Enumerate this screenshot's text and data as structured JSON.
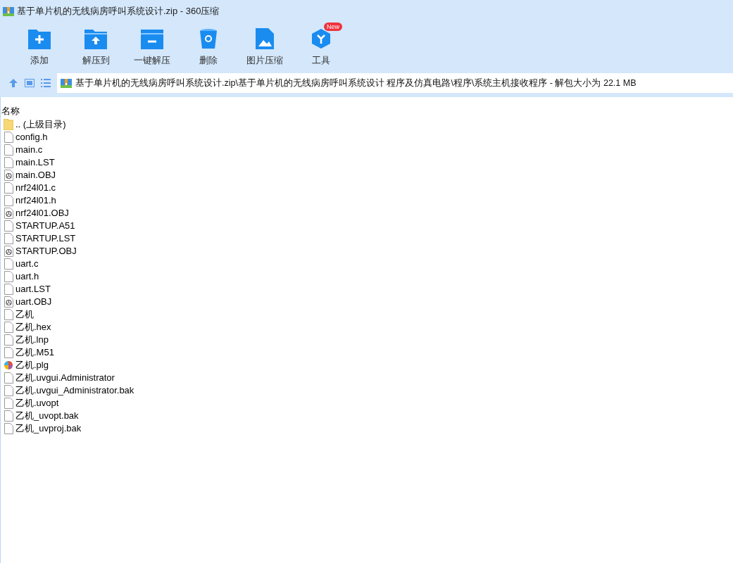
{
  "window": {
    "title": "基于单片机的无线病房呼叫系统设计.zip - 360压缩"
  },
  "toolbar": [
    {
      "kind": "add",
      "label": "添加"
    },
    {
      "kind": "extract",
      "label": "解压到"
    },
    {
      "kind": "oneclick",
      "label": "一键解压"
    },
    {
      "kind": "delete",
      "label": "删除"
    },
    {
      "kind": "image",
      "label": "图片压缩"
    },
    {
      "kind": "tools",
      "label": "工具",
      "badge": "New"
    }
  ],
  "address": {
    "path": "基于单片机的无线病房呼叫系统设计.zip\\基于单片机的无线病房呼叫系统设计 程序及仿真电路\\程序\\系统主机接收程序 - 解包大小为 22.1 MB"
  },
  "table": {
    "columns": [
      "名称"
    ],
    "rows": [
      {
        "kind": "folder",
        "name": ".. (上级目录)"
      },
      {
        "kind": "file",
        "name": "config.h"
      },
      {
        "kind": "file",
        "name": "main.c"
      },
      {
        "kind": "file",
        "name": "main.LST"
      },
      {
        "kind": "obj",
        "name": "main.OBJ"
      },
      {
        "kind": "file",
        "name": "nrf24l01.c"
      },
      {
        "kind": "file",
        "name": "nrf24l01.h"
      },
      {
        "kind": "obj",
        "name": "nrf24l01.OBJ"
      },
      {
        "kind": "file",
        "name": "STARTUP.A51"
      },
      {
        "kind": "file",
        "name": "STARTUP.LST"
      },
      {
        "kind": "obj",
        "name": "STARTUP.OBJ"
      },
      {
        "kind": "file",
        "name": "uart.c"
      },
      {
        "kind": "file",
        "name": "uart.h"
      },
      {
        "kind": "file",
        "name": "uart.LST"
      },
      {
        "kind": "obj",
        "name": "uart.OBJ"
      },
      {
        "kind": "file",
        "name": "乙机"
      },
      {
        "kind": "file",
        "name": "乙机.hex"
      },
      {
        "kind": "file",
        "name": "乙机.lnp"
      },
      {
        "kind": "file",
        "name": "乙机.M51"
      },
      {
        "kind": "plg",
        "name": "乙机.plg"
      },
      {
        "kind": "file",
        "name": "乙机.uvgui.Administrator"
      },
      {
        "kind": "file",
        "name": "乙机.uvgui_Administrator.bak"
      },
      {
        "kind": "file",
        "name": "乙机.uvopt"
      },
      {
        "kind": "file",
        "name": "乙机_uvopt.bak"
      },
      {
        "kind": "file",
        "name": "乙机_uvproj.bak"
      }
    ]
  }
}
